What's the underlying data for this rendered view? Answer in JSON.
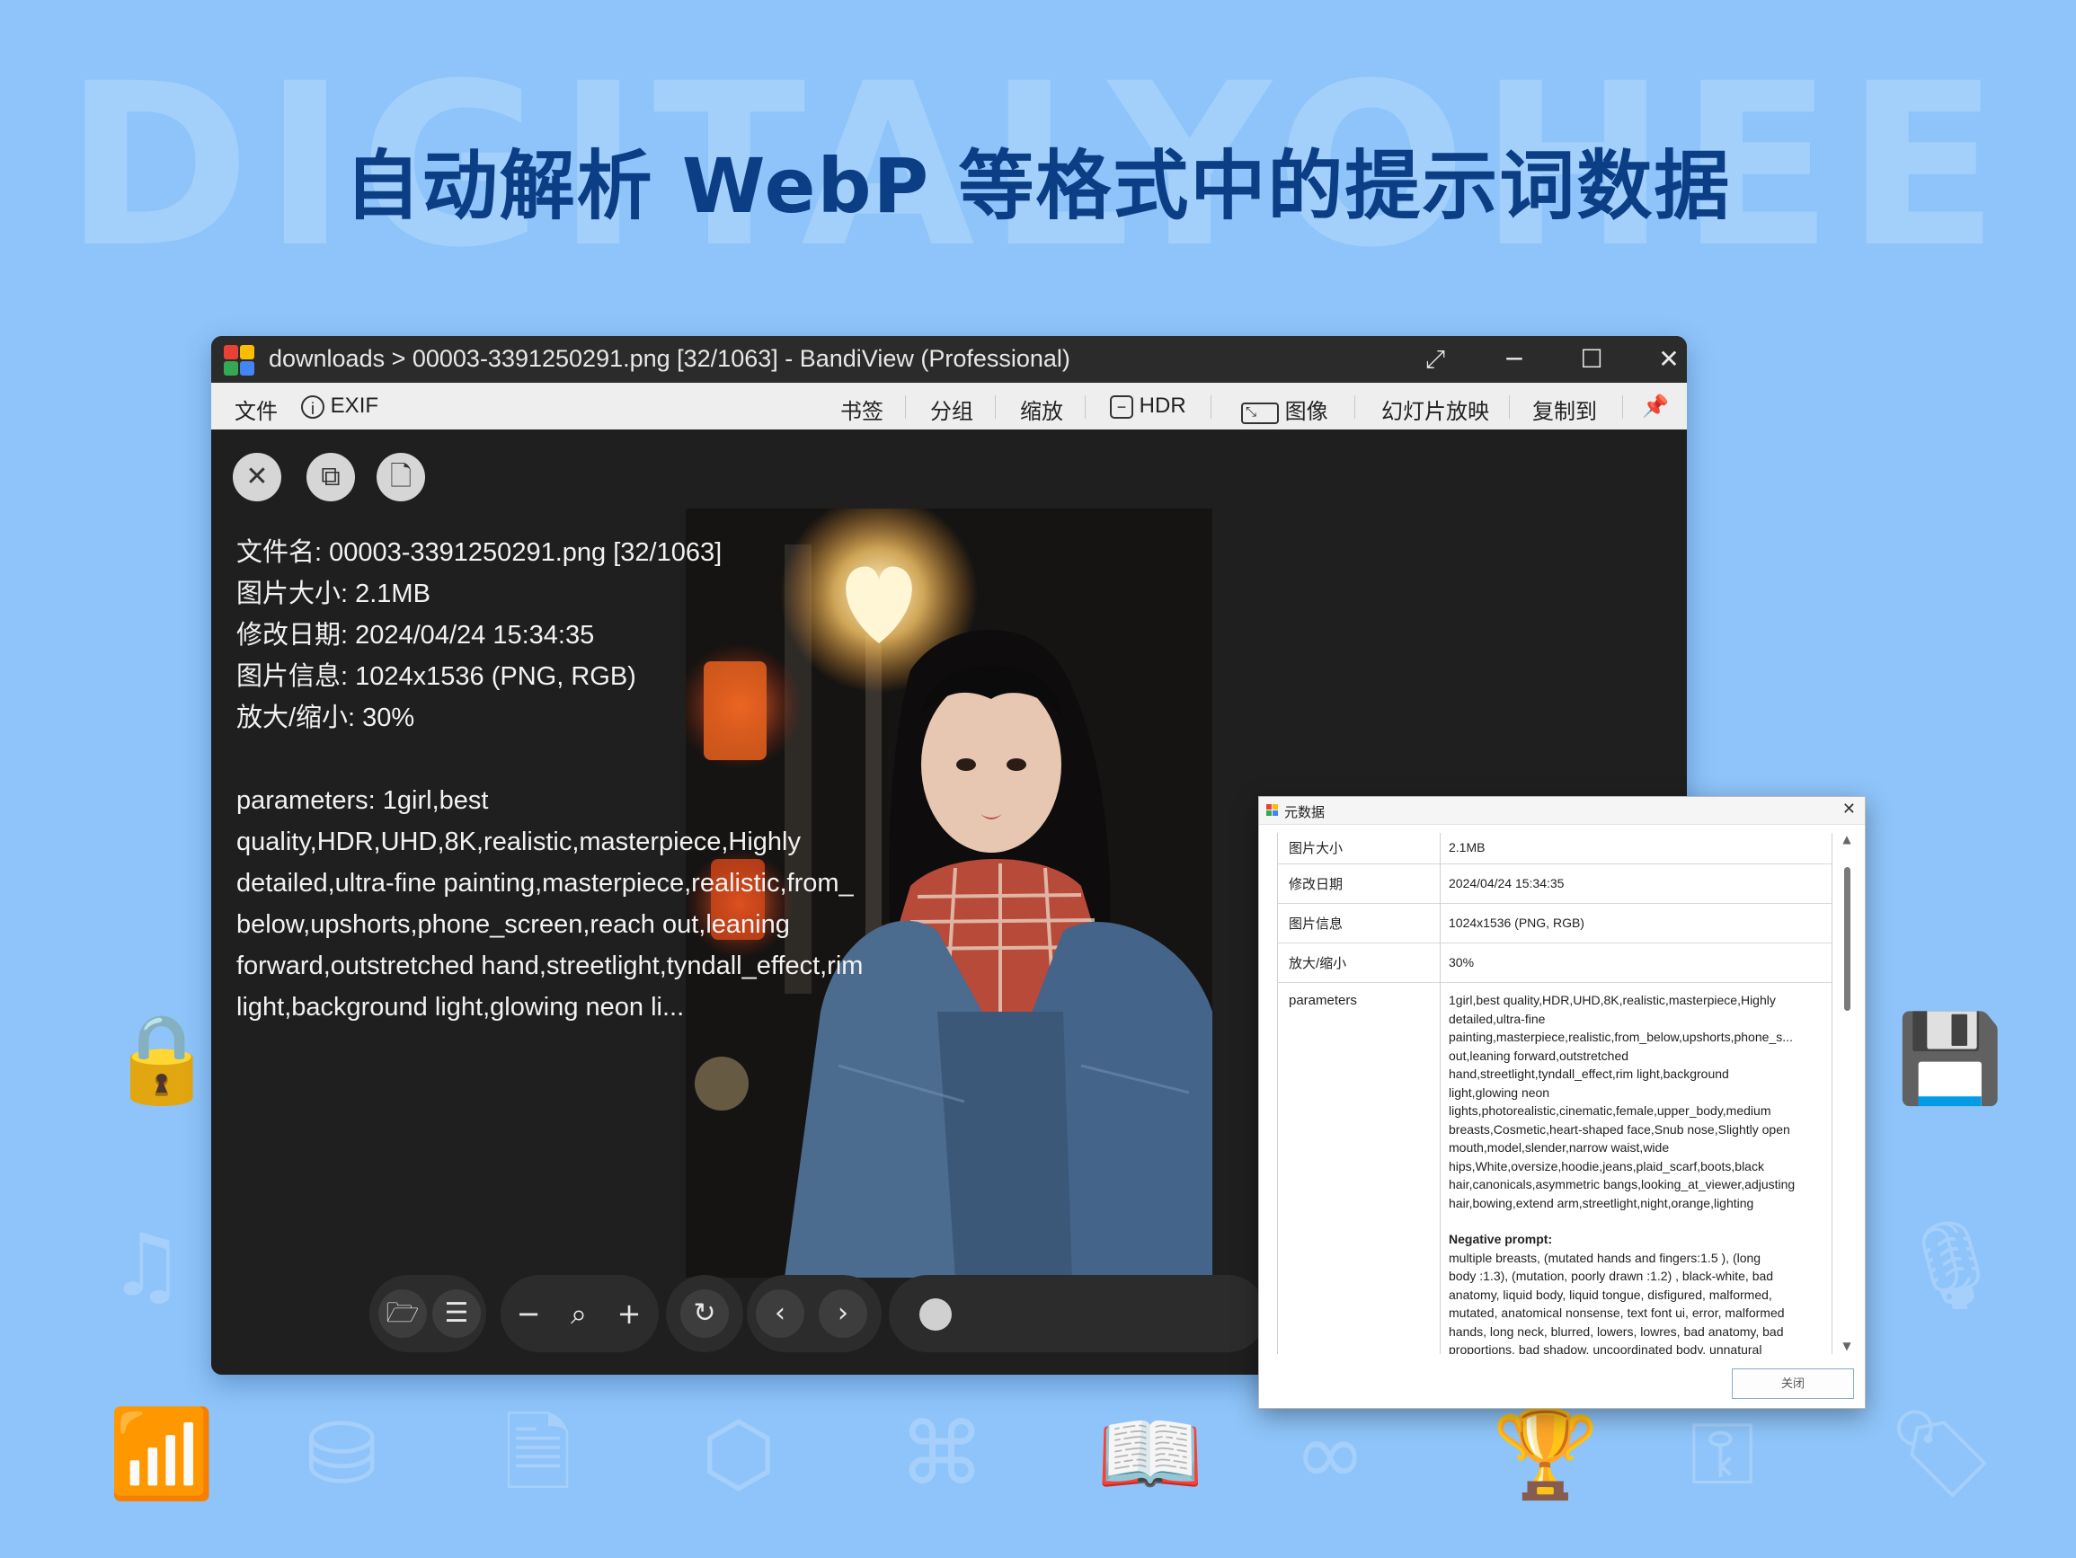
{
  "background": {
    "watermark": "DIGITALYOHEE",
    "headline": "自动解析 WebP 等格式中的提示词数据",
    "color": "#8ec4f9",
    "headline_color": "#0c3e86"
  },
  "window": {
    "title": "downloads > 00003-3391250291.png [32/1063] - BandiView (Professional)",
    "controls": {
      "fullscreen_icon": "expand-icon",
      "minimize_icon": "minimize-icon",
      "maximize_icon": "maximize-icon",
      "close_icon": "close-icon"
    },
    "menu": {
      "file": "文件",
      "exif": "EXIF",
      "bookmark": "书签",
      "group": "分组",
      "zoom": "缩放",
      "hdr": "HDR",
      "image": "图像",
      "slideshow": "幻灯片放映",
      "copy_to": "复制到"
    },
    "info": {
      "filename": "文件名: 00003-3391250291.png [32/1063]",
      "size": "图片大小: 2.1MB",
      "modified": "修改日期: 2024/04/24 15:34:35",
      "imageinfo": "图片信息: 1024x1536 (PNG, RGB)",
      "zoom": "放大/缩小: 30%",
      "parameters": "parameters: 1girl,best quality,HDR,UHD,8K,realistic,masterpiece,Highly detailed,ultra-fine painting,masterpiece,realistic,from_ below,upshorts,phone_screen,reach out,leaning forward,outstretched hand,streetlight,tyndall_effect,rim light,background light,glowing neon li..."
    }
  },
  "dialog": {
    "title": "元数据",
    "rows": [
      {
        "key": "图片大小",
        "value": "2.1MB"
      },
      {
        "key": "修改日期",
        "value": "2024/04/24 15:34:35"
      },
      {
        "key": "图片信息",
        "value": "1024x1536 (PNG, RGB)"
      },
      {
        "key": "放大/缩小",
        "value": "30%"
      },
      {
        "key": "parameters",
        "value_lines": [
          "1girl,best quality,HDR,UHD,8K,realistic,masterpiece,Highly",
          "detailed,ultra-fine",
          "painting,masterpiece,realistic,from_below,upshorts,phone_s...",
          "out,leaning forward,outstretched",
          "hand,streetlight,tyndall_effect,rim light,background",
          "light,glowing neon",
          "lights,photorealistic,cinematic,female,upper_body,medium",
          "breasts,Cosmetic,heart-shaped face,Snub nose,Slightly open",
          "mouth,model,slender,narrow waist,wide",
          "hips,White,oversize,hoodie,jeans,plaid_scarf,boots,black",
          "hair,canonicals,asymmetric bangs,looking_at_viewer,adjusting",
          "hair,bowing,extend arm,streetlight,night,orange,lighting"
        ],
        "negative_label": "Negative prompt:",
        "negative_lines": [
          "multiple breasts, (mutated hands and fingers:1.5 ), (long",
          "body :1.3), (mutation, poorly drawn :1.2) , black-white, bad",
          "anatomy, liquid body, liquid tongue, disfigured, malformed,",
          "mutated, anatomical nonsense, text font ui, error, malformed",
          "hands, long neck, blurred, lowers, lowres, bad anatomy, bad",
          "proportions, bad shadow, uncoordinated body, unnatural"
        ]
      }
    ],
    "close_label": "关闭"
  }
}
